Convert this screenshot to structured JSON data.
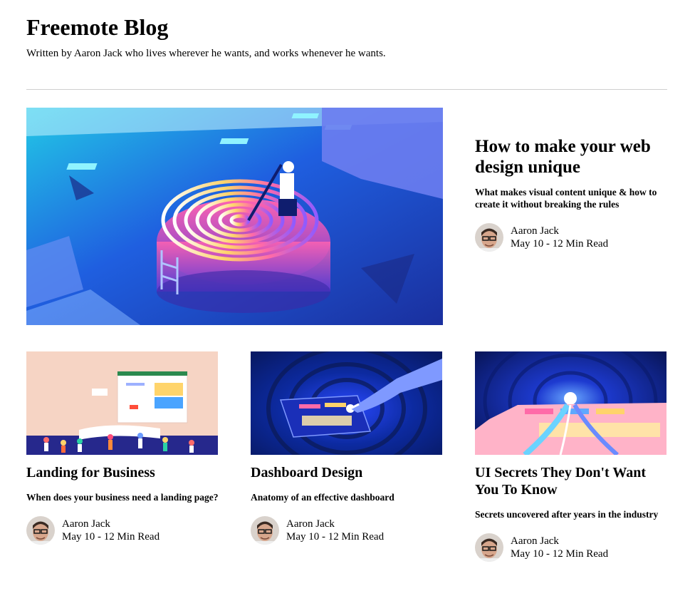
{
  "site": {
    "title": "Freemote Blog",
    "subtitle": "Written by Aaron Jack who lives wherever he wants, and works whenever he wants."
  },
  "featured": {
    "title": "How to make your web design unique",
    "description": "What makes visual content unique & how to create it without breaking the rules",
    "author": "Aaron Jack",
    "date_read": "May 10 - 12 Min Read",
    "image_icon": "fingerprint-pool-illustration"
  },
  "posts": [
    {
      "title": "Landing for Business",
      "description": "When does your business need a landing page?",
      "author": "Aaron Jack",
      "date_read": "May 10 - 12 Min Read",
      "image_icon": "landing-page-crowd-illustration"
    },
    {
      "title": "Dashboard Design",
      "description": "Anatomy of an effective dashboard",
      "author": "Aaron Jack",
      "date_read": "May 10 - 12 Min Read",
      "image_icon": "dashboard-tablet-hand-illustration"
    },
    {
      "title": "UI Secrets They Don't Want You To Know",
      "description": "Secrets uncovered after years in the industry",
      "author": "Aaron Jack",
      "date_read": "May 10 - 12 Min Read",
      "image_icon": "ui-cosmic-portal-illustration"
    }
  ],
  "colors": {
    "text": "#000000",
    "divider": "#cfcfcf",
    "featured_bg": "#1d4fd8",
    "accent_cyan": "#29d9e8",
    "landing_bg": "#f6d4c4",
    "landing_floor": "#26288c",
    "dashboard_bg": "#0c2aa0",
    "ui_bg": "#0a1a6b"
  }
}
